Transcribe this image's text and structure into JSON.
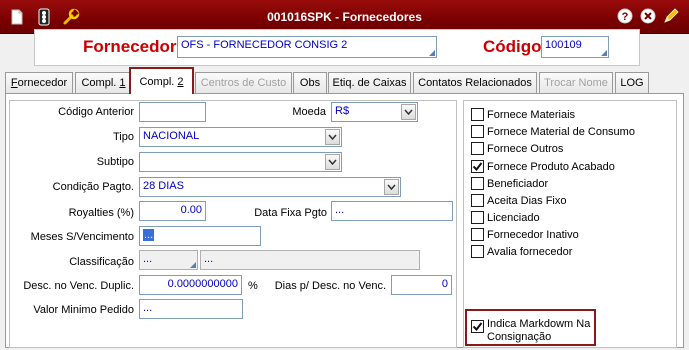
{
  "window": {
    "title": "001016SPK - Fornecedores",
    "icons": [
      "traffic-light-icon",
      "wrench-icon"
    ],
    "right_icons": [
      "help-icon",
      "close-icon",
      "pencil-icon"
    ]
  },
  "header": {
    "supplier_label": "Fornecedor",
    "supplier_value": "OFS - FORNECEDOR CONSIG 2",
    "code_label": "Código",
    "code_value": "100109"
  },
  "tabs": {
    "t0": "ornecedor",
    "t0_hotkey": "F",
    "t1": "Compl. ",
    "t1_hotkey": "1",
    "t2": "Compl. ",
    "t2_hotkey": "2",
    "t3": "Centros de Custo",
    "t4": "Obs",
    "t5": "Etiq. de Caixas",
    "t6": "Contatos Relacionados",
    "t7": "Trocar Nome",
    "t8": "LOG"
  },
  "form": {
    "codigo_anterior_label": "Código Anterior",
    "codigo_anterior_value": "",
    "moeda_label": "Moeda",
    "moeda_value": "R$",
    "tipo_label": "Tipo",
    "tipo_value": "NACIONAL",
    "subtipo_label": "Subtipo",
    "subtipo_value": "",
    "condicao_label": "Condição Pagto.",
    "condicao_value": "28 DIAS",
    "royalties_label": "Royalties (%)",
    "royalties_value": "0.00",
    "data_fixa_label": "Data Fixa Pgto",
    "data_fixa_value": "...",
    "meses_label": "Meses S/Vencimento",
    "meses_value": "...",
    "classificacao_label": "Classificação",
    "classificacao_value": "...",
    "classificacao_desc": "...",
    "desc_venc_label": "Desc. no Venc. Duplic.",
    "desc_venc_value": "0.0000000000",
    "percent_symbol": "%",
    "dias_desc_label": "Dias p/ Desc. no Venc.",
    "dias_desc_value": "0",
    "valor_minimo_label": "Valor Minimo Pedido",
    "valor_minimo_value": "..."
  },
  "checkboxes": {
    "c0": "Fornece Materiais",
    "c1": "Fornece Material de  Consumo",
    "c2": "Fornece Outros",
    "c3": "Fornece Produto  Acabado",
    "c4": "Beneficiador",
    "c5": "Aceita Dias Fixo",
    "c6": "Licenciado",
    "c7": "Fornecedor Inativo",
    "c8": "Avalia fornecedor",
    "markdown_line1": "Indica Markdowm Na",
    "markdown_line2": "Consignação",
    "checked": {
      "fornece_produto_acabado": true,
      "indica_markdown": true
    }
  }
}
